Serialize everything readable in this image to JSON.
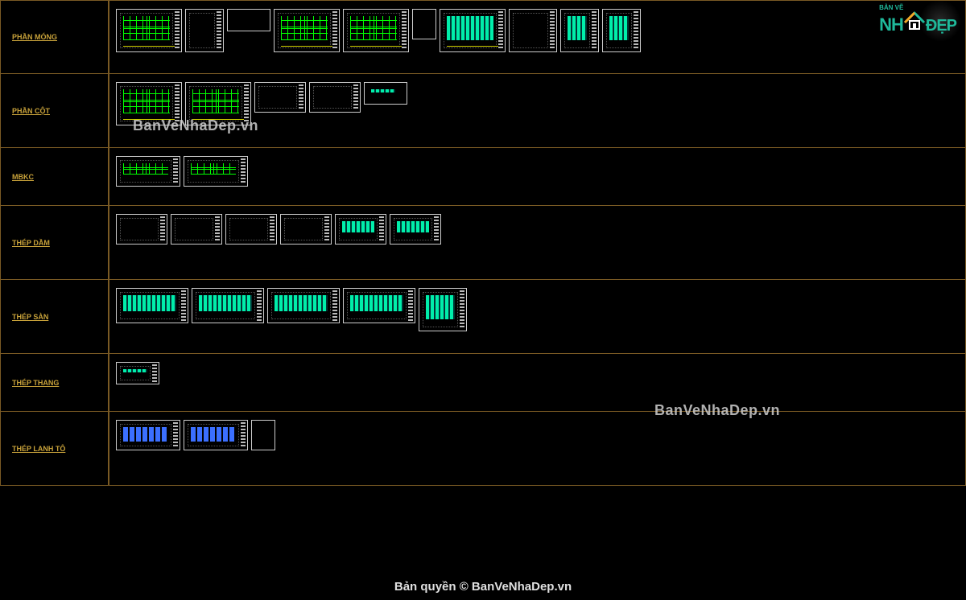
{
  "rows": [
    {
      "label": "PHẦN MÓNG"
    },
    {
      "label": "PHẦN CỘT"
    },
    {
      "label": "MBKC"
    },
    {
      "label": "THÉP DẦM"
    },
    {
      "label": "THÉP SÀN"
    },
    {
      "label": "THÉP THANG"
    },
    {
      "label": "THÉP LANH TÔ"
    }
  ],
  "watermark": "BanVeNhaDep.vn",
  "footer": "Bản quyền © BanVeNhaDep.vn",
  "logo": {
    "top": "BẢN VẼ",
    "left": "NH",
    "right": "ĐẸP"
  }
}
